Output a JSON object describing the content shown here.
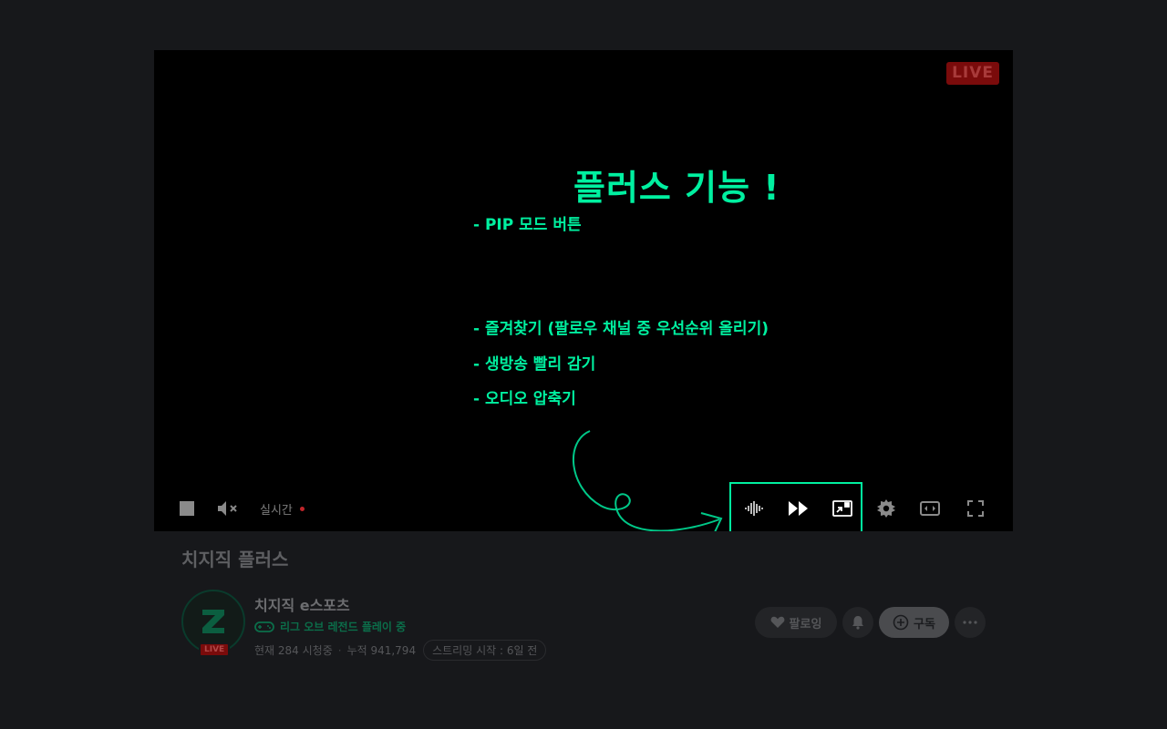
{
  "player": {
    "live_badge": "LIVE",
    "overlay": {
      "title": "플러스 기능 !",
      "items": [
        "- PIP 모드 버튼",
        "- 즐겨찾기 (팔로우 채널 중 우선순위 올리기)",
        "- 생방송 빨리 감기",
        "- 오디오 압축기"
      ]
    },
    "controls": {
      "realtime_label": "실시간",
      "icons": [
        "stop-icon",
        "mute-icon",
        "audio-compressor-icon",
        "fast-forward-icon",
        "pip-icon",
        "settings-icon",
        "wide-mode-icon",
        "fullscreen-icon"
      ]
    },
    "accent_color": "#00f0a0"
  },
  "stream": {
    "title": "치지직 플러스",
    "channel_name": "치지직 e스포츠",
    "category": "리그 오브 레전드 플레이 중",
    "viewers": "현재 284 시청중",
    "cumulative": "누적 941,794",
    "started": "스트리밍 시작 : 6일 전",
    "avatar_live": "LIVE"
  },
  "actions": {
    "following_label": "팔로잉",
    "subscribe_label": "구독"
  }
}
